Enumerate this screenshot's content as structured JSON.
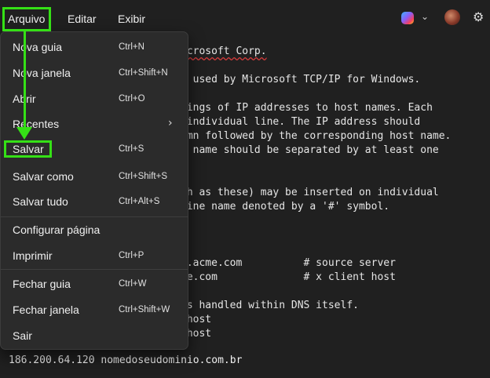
{
  "menubar": {
    "items": [
      "Arquivo",
      "Editar",
      "Exibir"
    ]
  },
  "icons": {
    "copilot": "copilot-icon",
    "chevron": "chevron-down-icon",
    "avatar": "avatar",
    "gear": "gear-icon"
  },
  "highlight_color": "#35e016",
  "file_menu": {
    "items": [
      {
        "label": "Nova guia",
        "shortcut": "Ctrl+N"
      },
      {
        "label": "Nova janela",
        "shortcut": "Ctrl+Shift+N"
      },
      {
        "label": "Abrir",
        "shortcut": "Ctrl+O"
      },
      {
        "label": "Recentes",
        "shortcut": ""
      },
      {
        "label": "Salvar",
        "shortcut": "Ctrl+S"
      },
      {
        "label": "Salvar como",
        "shortcut": "Ctrl+Shift+S"
      },
      {
        "label": "Salvar tudo",
        "shortcut": "Ctrl+Alt+S"
      },
      {
        "label": "Configurar página",
        "shortcut": ""
      },
      {
        "label": "Imprimir",
        "shortcut": "Ctrl+P"
      },
      {
        "label": "Fechar guia",
        "shortcut": "Ctrl+W"
      },
      {
        "label": "Fechar janela",
        "shortcut": "Ctrl+Shift+W"
      },
      {
        "label": "Sair",
        "shortcut": ""
      }
    ]
  },
  "editor": {
    "lines": [
      "icrosoft Corp.",
      "e used by Microsoft TCP/IP for Windows.",
      "pings of IP addresses to host names. Each",
      " individual line. The IP address should",
      "umn followed by the corresponding host name.",
      "t name should be separated by at least one",
      "ch as these) may be inserted on individual",
      "hine name denoted by a '#' symbol.",
      "o.acme.com          # source server",
      "me.com              # x client host",
      "is handled within DNS itself.",
      "lhost",
      "lhost"
    ],
    "last_line": "186.200.64.120 nomedoseudominio.com.br"
  }
}
